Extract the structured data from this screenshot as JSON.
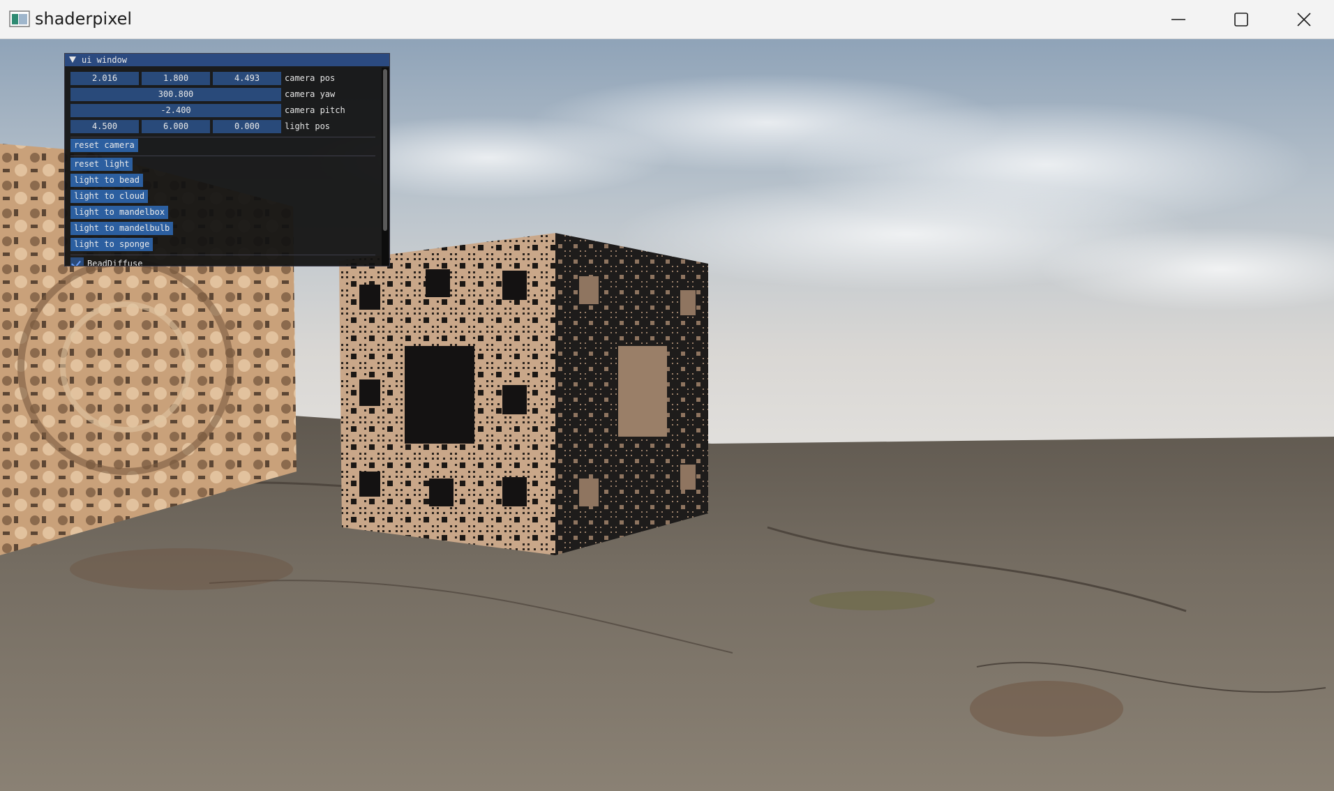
{
  "window": {
    "title": "shaderpixel",
    "app_icon": "app-icon",
    "controls": [
      "minimize-icon",
      "maximize-icon",
      "close-icon"
    ]
  },
  "ui_window": {
    "title": "ui window",
    "camera_pos": {
      "label": "camera pos",
      "x": "2.016",
      "y": "1.800",
      "z": "4.493"
    },
    "camera_yaw": {
      "label": "camera yaw",
      "value": "300.800"
    },
    "camera_pitch": {
      "label": "camera pitch",
      "value": "-2.400"
    },
    "light_pos": {
      "label": "light pos",
      "x": "4.500",
      "y": "6.000",
      "z": "0.000"
    },
    "buttons": {
      "reset_camera": "reset camera",
      "reset_light": "reset light",
      "light_to_bead": "light to bead",
      "light_to_cloud": "light to cloud",
      "light_to_mandelbox": "light to mandelbox",
      "light_to_mandelbulb": "light to mandelbulb",
      "light_to_sponge": "light to sponge"
    },
    "checkbox": {
      "label": "BeadDiffuse",
      "checked": true
    }
  },
  "colors": {
    "title_bar": "#2b4a80",
    "field_bg": "#294a7a",
    "button_bg": "#2c5fa0",
    "sponge": "#c8a585"
  }
}
